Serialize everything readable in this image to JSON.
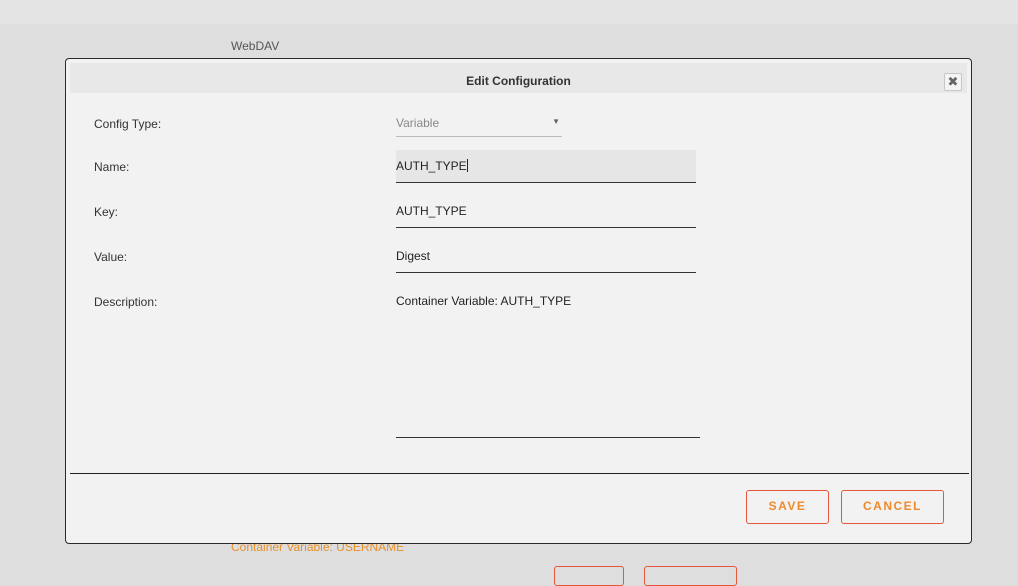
{
  "background": {
    "section_label": "WebDAV",
    "footer_text": "Container Variable: USERNAME"
  },
  "dialog": {
    "title": "Edit Configuration",
    "close_icon": "close-icon",
    "fields": {
      "config_type": {
        "label": "Config Type:",
        "value": "Variable"
      },
      "name": {
        "label": "Name:",
        "value": "AUTH_TYPE"
      },
      "key": {
        "label": "Key:",
        "value": "AUTH_TYPE"
      },
      "value": {
        "label": "Value:",
        "value": "Digest"
      },
      "description": {
        "label": "Description:",
        "value": "Container Variable: AUTH_TYPE"
      }
    },
    "buttons": {
      "save": "SAVE",
      "cancel": "CANCEL"
    }
  },
  "colors": {
    "accent_text": "#ef8a2c",
    "button_border": "#e4573a"
  }
}
